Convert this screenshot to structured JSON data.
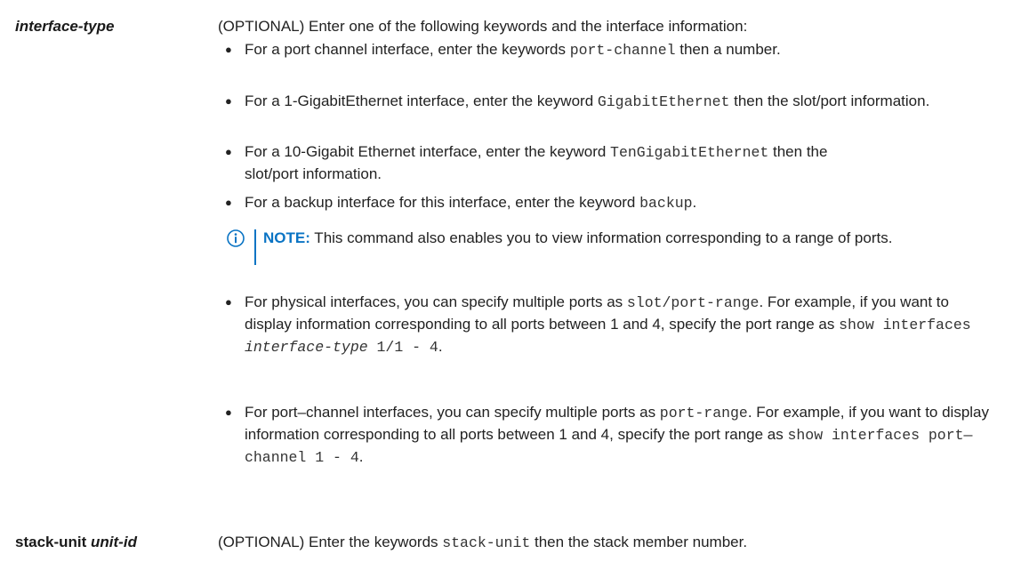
{
  "row1": {
    "term": "interface-type",
    "intro": "(OPTIONAL) Enter one of the following keywords and the interface information:",
    "bullets_a": [
      {
        "p1": "For a port channel interface, enter the keywords ",
        "c1": "port-channel",
        "p2": " then a number."
      },
      {
        "p1": "For a 1-GigabitEthernet interface, enter the keyword ",
        "c1": "GigabitEthernet",
        "p2": " then the slot/port information."
      },
      {
        "p1": "For a 10-Gigabit Ethernet interface, enter the keyword ",
        "c1": "TenGigabitEthernet",
        "p2": " then the slot/port information."
      },
      {
        "p1": "For a backup interface for this interface, enter the keyword ",
        "c1": "backup",
        "p2": "."
      }
    ],
    "note": {
      "label": "NOTE:",
      "text": " This command also enables you to view information corresponding to a range of ports."
    },
    "bullets_b": [
      {
        "p1": "For physical interfaces, you can specify multiple ports as ",
        "c1": "slot/port-range",
        "p2": ". For example, if you want to display information corresponding to all ports between 1 and 4, specify the port range as ",
        "c2": "show interfaces ",
        "c3": "interface-type",
        "c4": " 1/1 - 4",
        "p3": "."
      },
      {
        "p1": "For port–channel interfaces, you can specify multiple ports as ",
        "c1": "port-range",
        "p2": ". For example, if you want to display information corresponding to all ports between 1 and 4, specify the port range as ",
        "c2": "show interfaces port—channel 1 - 4",
        "p3": "."
      }
    ]
  },
  "row2": {
    "term_kw": "stack-unit",
    "term_arg": "unit-id",
    "p1": "(OPTIONAL) Enter the keywords ",
    "c1": "stack-unit",
    "p2": " then the stack member number."
  }
}
